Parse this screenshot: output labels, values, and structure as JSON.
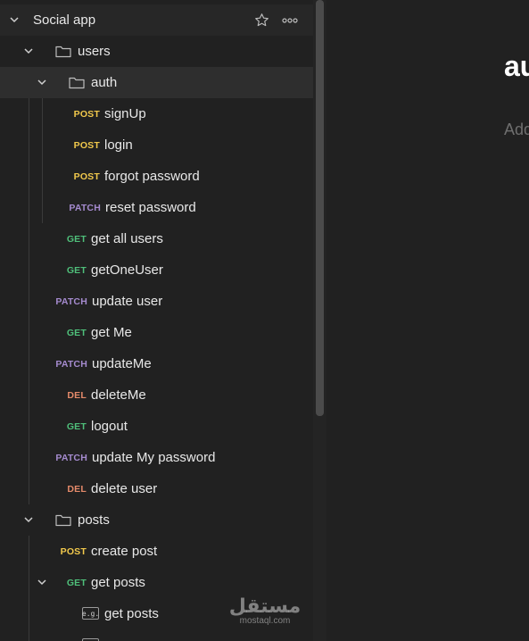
{
  "collection": {
    "name": "Social app"
  },
  "tree": {
    "users": "users",
    "auth": "auth",
    "signup": {
      "method": "POST",
      "label": "signUp"
    },
    "login": {
      "method": "POST",
      "label": "login"
    },
    "forgot": {
      "method": "POST",
      "label": "forgot password"
    },
    "reset": {
      "method": "PATCH",
      "label": "reset password"
    },
    "get_all": {
      "method": "GET",
      "label": "get all users"
    },
    "get_one": {
      "method": "GET",
      "label": "getOneUser"
    },
    "update_user": {
      "method": "PATCH",
      "label": "update user"
    },
    "get_me": {
      "method": "GET",
      "label": "get Me"
    },
    "update_me": {
      "method": "PATCH",
      "label": "updateMe"
    },
    "delete_me": {
      "method": "DEL",
      "label": "deleteMe"
    },
    "logout": {
      "method": "GET",
      "label": "logout"
    },
    "update_pwd": {
      "method": "PATCH",
      "label": "update My password"
    },
    "delete_user": {
      "method": "DEL",
      "label": "delete user"
    },
    "posts": "posts",
    "create_post": {
      "method": "POST",
      "label": "create post"
    },
    "get_posts": {
      "method": "GET",
      "label": "get posts"
    },
    "example_get_posts": {
      "tag": "e.g.",
      "label": "get posts"
    }
  },
  "main": {
    "title": "au",
    "description": "Add"
  },
  "watermark": {
    "arabic": "مستقل",
    "latin": "mostaql.com"
  },
  "colors": {
    "post": "#f2c94c",
    "get": "#4fbf7a",
    "patch": "#a58bcf",
    "del": "#e48a6a"
  }
}
